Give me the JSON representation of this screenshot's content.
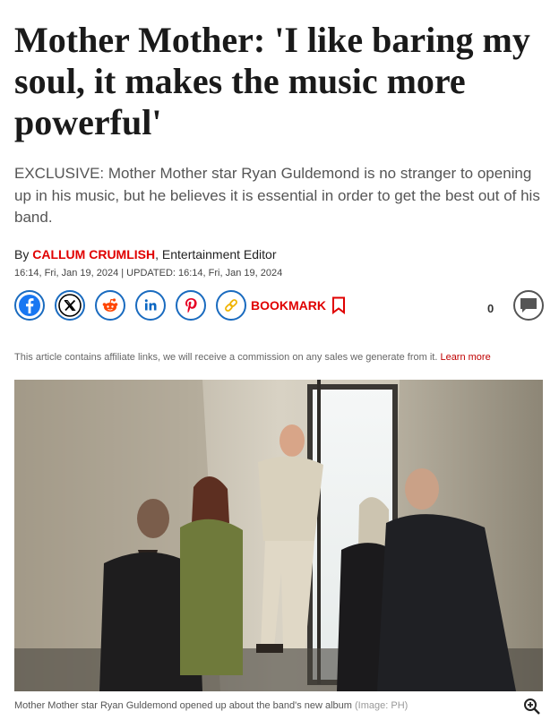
{
  "article": {
    "headline": "Mother Mother: 'I like baring my soul, it makes the music more powerful'",
    "standfirst": "EXCLUSIVE: Mother Mother star Ryan Guldemond is no stranger to opening up in his music, but he believes it is essential in order to get the best out of his band.",
    "byline_prefix": "By",
    "author": "CALLUM CRUMLISH",
    "author_role": ", Entertainment Editor",
    "dateline": "16:14, Fri, Jan 19, 2024 | UPDATED: 16:14, Fri, Jan 19, 2024"
  },
  "share": {
    "buttons": [
      {
        "name": "facebook-icon",
        "color": "#1877f2"
      },
      {
        "name": "x-twitter-icon",
        "color": "#000000"
      },
      {
        "name": "reddit-icon",
        "color": "#ff4500"
      },
      {
        "name": "linkedin-icon",
        "color": "#0a66c2"
      },
      {
        "name": "pinterest-icon",
        "color": "#e60023"
      },
      {
        "name": "link-icon",
        "color": "#f0b400"
      }
    ],
    "bookmark_label": "BOOKMARK",
    "comment_count": "0"
  },
  "affiliate": {
    "text": "This article contains affiliate links, we will receive a commission on any sales we generate from it.",
    "link_label": "Learn more"
  },
  "hero_image": {
    "caption": "Mother Mother star Ryan Guldemond opened up about the band's new album",
    "credit": "(Image: PH)"
  },
  "colors": {
    "accent": "#e00000",
    "share_ring": "#1a6bbf"
  }
}
